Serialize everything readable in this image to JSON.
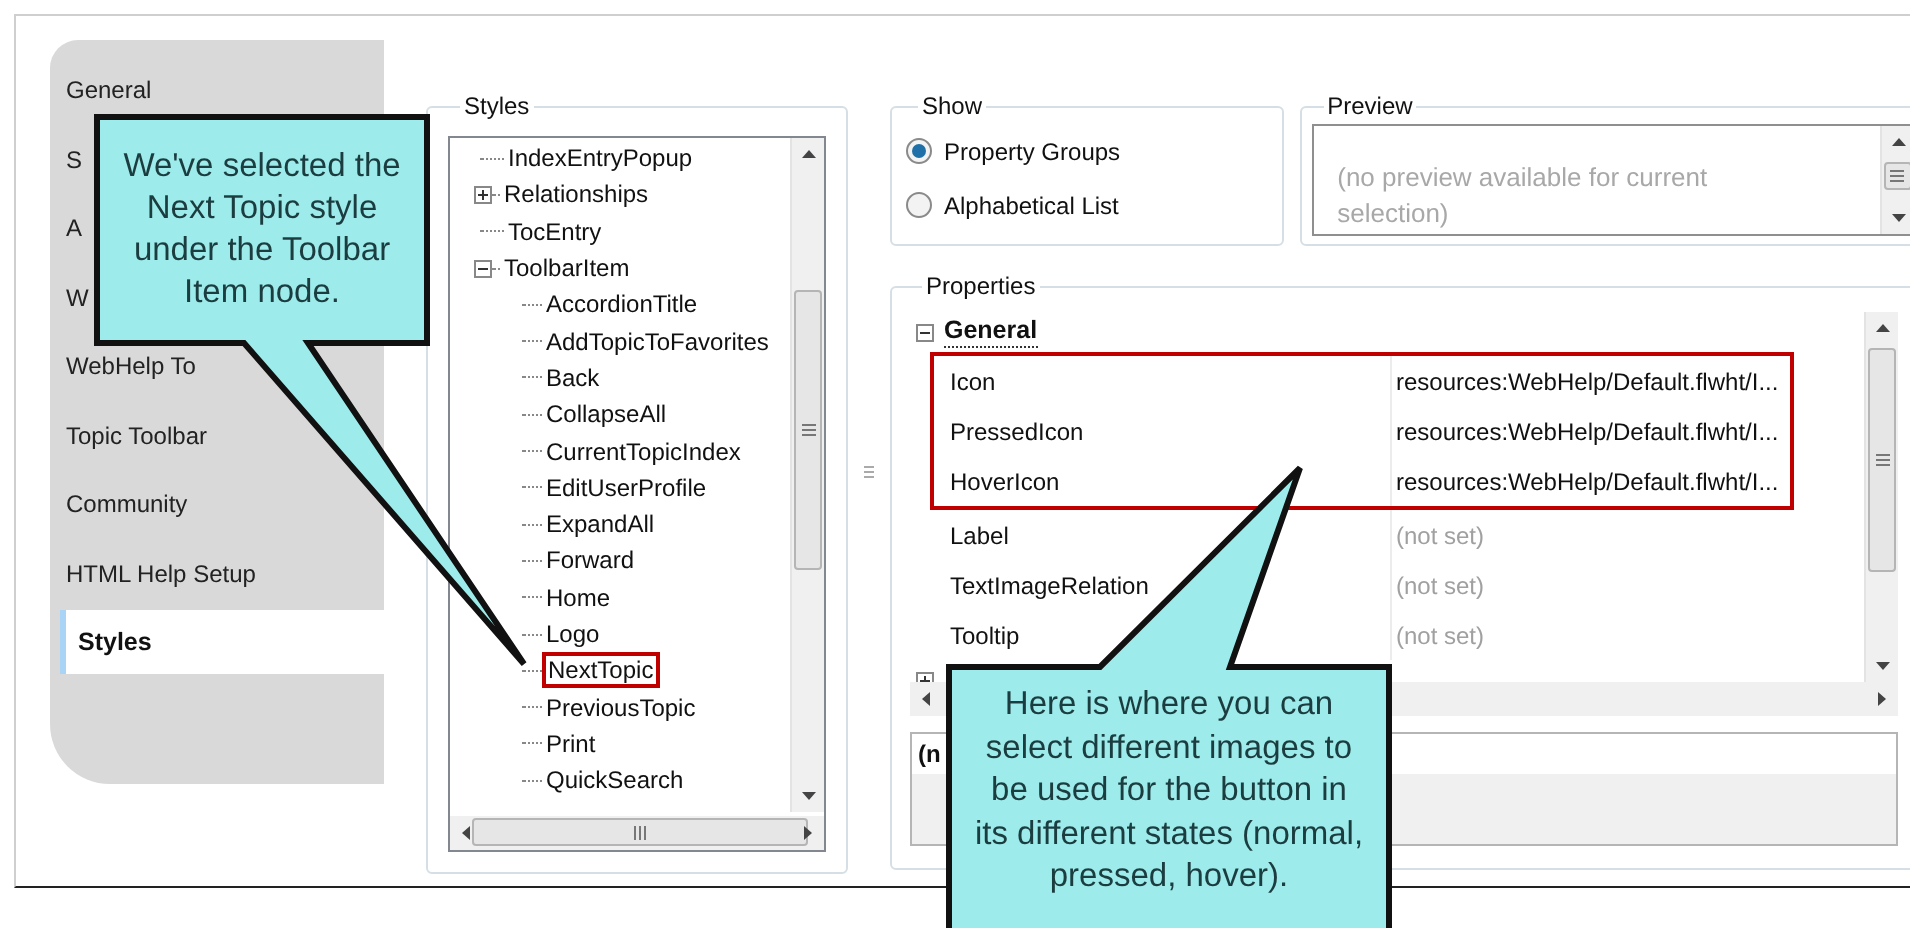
{
  "nav": {
    "items": [
      {
        "label": "General",
        "selected": false
      },
      {
        "label": "S",
        "selected": false
      },
      {
        "label": "A",
        "selected": false
      },
      {
        "label": "W",
        "selected": false
      },
      {
        "label": "WebHelp To",
        "selected": false
      },
      {
        "label": "Topic Toolbar",
        "selected": false
      },
      {
        "label": "Community",
        "selected": false
      },
      {
        "label": "HTML Help Setup",
        "selected": false
      },
      {
        "label": "Styles",
        "selected": true
      }
    ]
  },
  "styles": {
    "title": "Styles",
    "tree": [
      {
        "label": "IndexEntryPopup",
        "highlighted": false
      },
      {
        "label": "Relationships",
        "expanded": false,
        "highlighted": false
      },
      {
        "label": "TocEntry",
        "highlighted": false
      },
      {
        "label": "ToolbarItem",
        "expanded": true,
        "highlighted": false,
        "children": [
          {
            "label": "AccordionTitle",
            "highlighted": false
          },
          {
            "label": "AddTopicToFavorites",
            "highlighted": false
          },
          {
            "label": "Back",
            "highlighted": false
          },
          {
            "label": "CollapseAll",
            "highlighted": false
          },
          {
            "label": "CurrentTopicIndex",
            "highlighted": false
          },
          {
            "label": "EditUserProfile",
            "highlighted": false
          },
          {
            "label": "ExpandAll",
            "highlighted": false
          },
          {
            "label": "Forward",
            "highlighted": false
          },
          {
            "label": "Home",
            "highlighted": false
          },
          {
            "label": "Logo",
            "highlighted": false
          },
          {
            "label": "NextTopic",
            "highlighted": true
          },
          {
            "label": "PreviousTopic",
            "highlighted": false
          },
          {
            "label": "Print",
            "highlighted": false
          },
          {
            "label": "QuickSearch",
            "highlighted": false
          }
        ]
      }
    ]
  },
  "show": {
    "title": "Show",
    "options": [
      {
        "label": "Property Groups",
        "selected": true
      },
      {
        "label": "Alphabetical List",
        "selected": false
      }
    ]
  },
  "preview": {
    "title": "Preview",
    "text": "(no preview available for current selection)"
  },
  "properties": {
    "title": "Properties",
    "categories": [
      {
        "name": "General",
        "expanded": true,
        "rows": [
          {
            "name": "Icon",
            "value": "resources:WebHelp/Default.flwht/I...",
            "set": true,
            "highlighted": true
          },
          {
            "name": "PressedIcon",
            "value": "resources:WebHelp/Default.flwht/I...",
            "set": true,
            "highlighted": true
          },
          {
            "name": "HoverIcon",
            "value": "resources:WebHelp/Default.flwht/I...",
            "set": true,
            "highlighted": true
          },
          {
            "name": "Label",
            "value": "(not set)",
            "set": false,
            "highlighted": false
          },
          {
            "name": "TextImageRelation",
            "value": "(not set)",
            "set": false,
            "highlighted": false
          },
          {
            "name": "Tooltip",
            "value": "(not set)",
            "set": false,
            "highlighted": false
          }
        ]
      },
      {
        "expanded": false
      }
    ],
    "description": "(n"
  },
  "callouts": [
    {
      "text": "We've selected the Next Topic style under the Toolbar Item node."
    },
    {
      "text": "Here is where you can select different images to be used for the button in its different states (normal, pressed, hover)."
    }
  ]
}
